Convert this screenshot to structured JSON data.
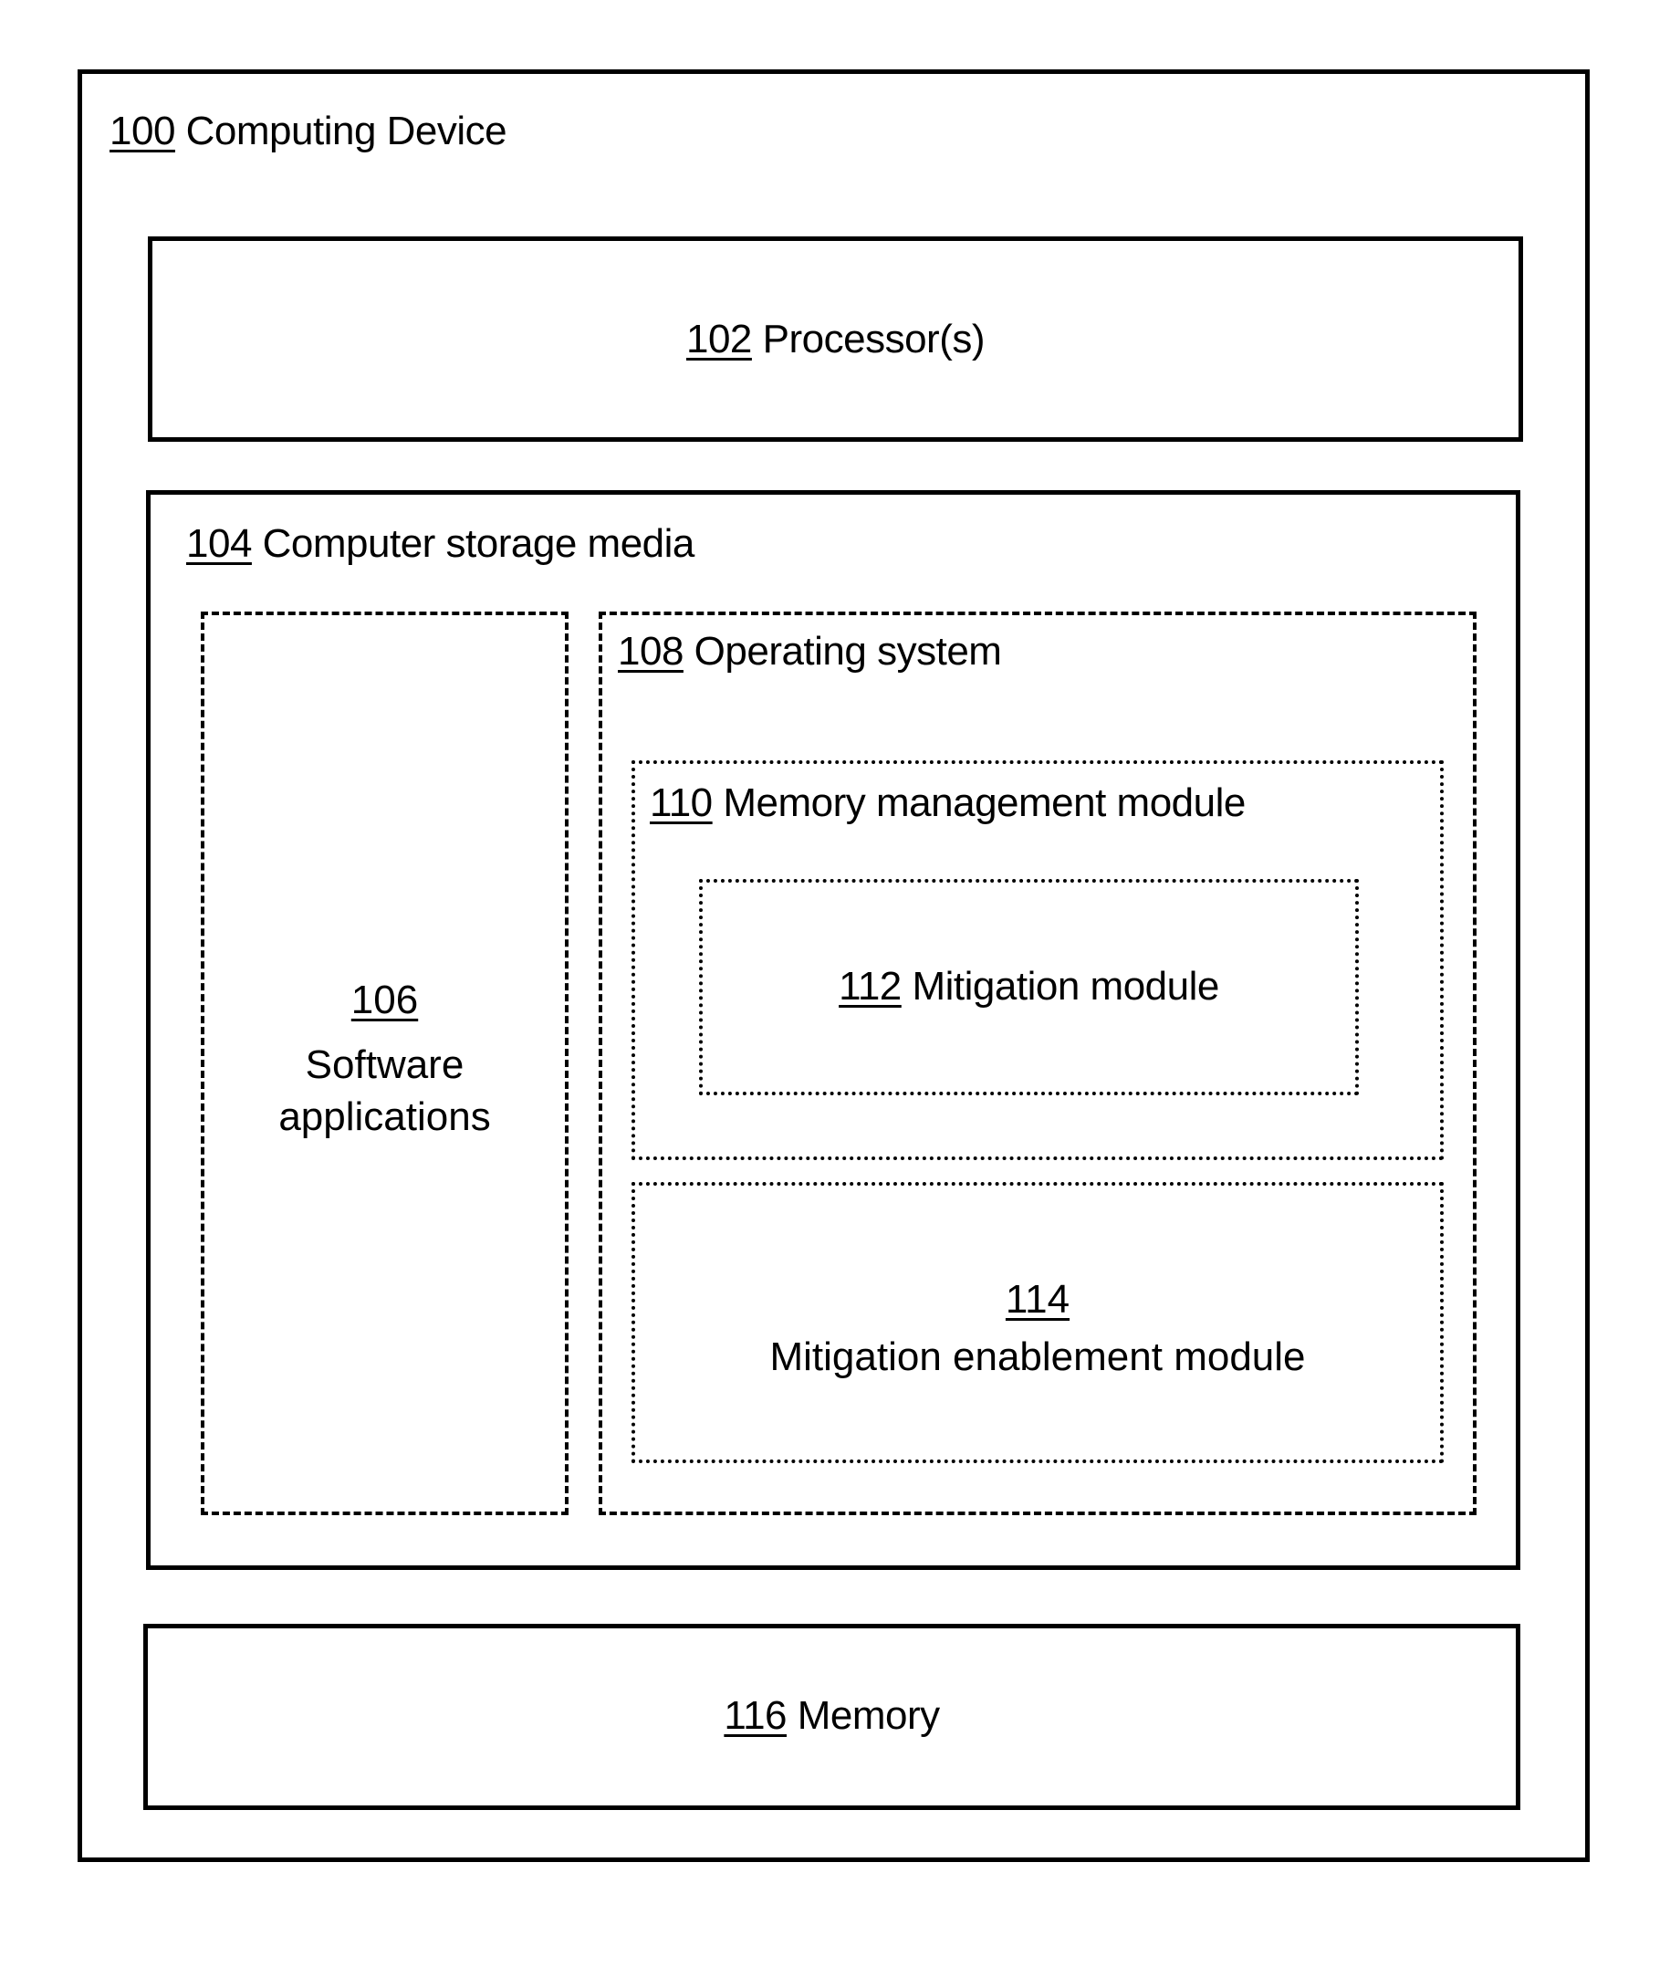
{
  "diagram": {
    "computing_device": {
      "number": "100",
      "text": " Computing Device"
    },
    "processor": {
      "number": "102",
      "text": " Processor(s)"
    },
    "storage_media": {
      "number": "104",
      "text": " Computer storage media"
    },
    "software_applications": {
      "number": "106",
      "text_line1": "Software",
      "text_line2": "applications"
    },
    "operating_system": {
      "number": "108",
      "text": " Operating system"
    },
    "memory_management_module": {
      "number": "110",
      "text": " Memory management module"
    },
    "mitigation_module": {
      "number": "112",
      "text": " Mitigation module"
    },
    "mitigation_enablement_module": {
      "number": "114",
      "text": "Mitigation enablement module"
    },
    "memory": {
      "number": "116",
      "text": " Memory"
    }
  }
}
